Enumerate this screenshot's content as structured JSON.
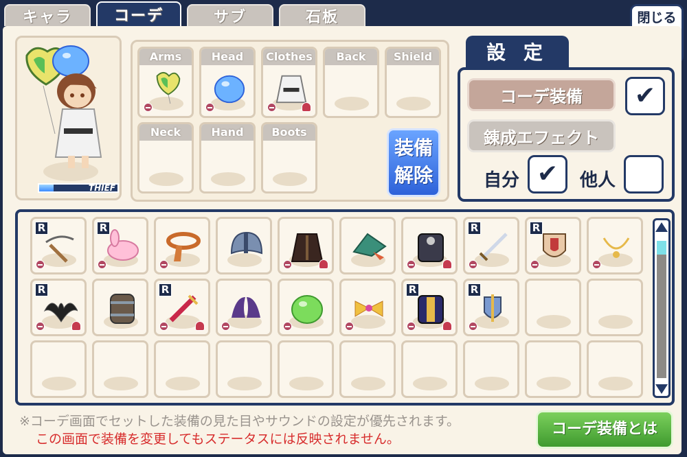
{
  "tabs": [
    "キャラ",
    "コーデ",
    "サブ",
    "石板"
  ],
  "close_label": "閉じる",
  "close_x": "✕",
  "character": {
    "class_label": "THIEF"
  },
  "slots": [
    {
      "label": "Arms",
      "item": "balloon-heart-icon",
      "minus": true,
      "pin": false
    },
    {
      "label": "Head",
      "item": "blue-slime-hat-icon",
      "minus": true,
      "pin": false
    },
    {
      "label": "Clothes",
      "item": "white-dress-icon",
      "minus": true,
      "pin": true
    },
    {
      "label": "Back",
      "item": "",
      "minus": false,
      "pin": false
    },
    {
      "label": "Shield",
      "item": "",
      "minus": false,
      "pin": false
    },
    {
      "label": "Neck",
      "item": "",
      "minus": false,
      "pin": false
    },
    {
      "label": "Hand",
      "item": "",
      "minus": false,
      "pin": false
    },
    {
      "label": "Boots",
      "item": "",
      "minus": false,
      "pin": false
    }
  ],
  "unequip_label_1": "装備",
  "unequip_label_2": "解除",
  "settings": {
    "title": "設 定",
    "coord_equip_label": "コーデ装備",
    "coord_equip_checked": "✔",
    "alchemy_effect_label": "錬成エフェクト",
    "self_label": "自分",
    "self_checked": "✔",
    "others_label": "他人",
    "others_checked": ""
  },
  "inventory": [
    {
      "icon": "whip-icon",
      "r": true,
      "minus": true,
      "pin": false
    },
    {
      "icon": "pink-rabbit-icon",
      "r": true,
      "minus": true,
      "pin": false
    },
    {
      "icon": "scarf-icon",
      "r": false,
      "minus": true,
      "pin": false
    },
    {
      "icon": "steel-helmet-icon",
      "r": false,
      "minus": false,
      "pin": false
    },
    {
      "icon": "dark-coat-icon",
      "r": false,
      "minus": true,
      "pin": true
    },
    {
      "icon": "green-hat-icon",
      "r": false,
      "minus": false,
      "pin": false
    },
    {
      "icon": "dark-armor-icon",
      "r": false,
      "minus": true,
      "pin": true
    },
    {
      "icon": "sword-icon",
      "r": true,
      "minus": true,
      "pin": false
    },
    {
      "icon": "red-shield-icon",
      "r": true,
      "minus": true,
      "pin": false
    },
    {
      "icon": "necklace-icon",
      "r": false,
      "minus": true,
      "pin": false
    },
    {
      "icon": "black-bat-icon",
      "r": true,
      "minus": true,
      "pin": true
    },
    {
      "icon": "barrel-icon",
      "r": false,
      "minus": false,
      "pin": false
    },
    {
      "icon": "red-dagger-icon",
      "r": true,
      "minus": true,
      "pin": true
    },
    {
      "icon": "purple-wings-icon",
      "r": false,
      "minus": true,
      "pin": false
    },
    {
      "icon": "green-slime-icon",
      "r": false,
      "minus": true,
      "pin": false
    },
    {
      "icon": "ribbon-icon",
      "r": false,
      "minus": true,
      "pin": false
    },
    {
      "icon": "gold-armor-icon",
      "r": true,
      "minus": true,
      "pin": true
    },
    {
      "icon": "winged-shield-icon",
      "r": true,
      "minus": true,
      "pin": false
    },
    {
      "icon": "",
      "r": false,
      "minus": false,
      "pin": false
    },
    {
      "icon": "",
      "r": false,
      "minus": false,
      "pin": false
    },
    {
      "icon": "",
      "r": false,
      "minus": false,
      "pin": false
    },
    {
      "icon": "",
      "r": false,
      "minus": false,
      "pin": false
    },
    {
      "icon": "",
      "r": false,
      "minus": false,
      "pin": false
    },
    {
      "icon": "",
      "r": false,
      "minus": false,
      "pin": false
    },
    {
      "icon": "",
      "r": false,
      "minus": false,
      "pin": false
    },
    {
      "icon": "",
      "r": false,
      "minus": false,
      "pin": false
    },
    {
      "icon": "",
      "r": false,
      "minus": false,
      "pin": false
    },
    {
      "icon": "",
      "r": false,
      "minus": false,
      "pin": false
    },
    {
      "icon": "",
      "r": false,
      "minus": false,
      "pin": false
    },
    {
      "icon": "",
      "r": false,
      "minus": false,
      "pin": false
    }
  ],
  "r_badge": "R",
  "note_info": "※コーデ画面でセットした装備の見た目やサウンドの設定が優先されます。",
  "note_warning": "この画面で装備を変更してもステータスには反映されません。",
  "help_button": "コーデ装備とは",
  "colors": {
    "navy": "#233966",
    "accent_blue": "#2e62d9",
    "green": "#3f9a2f",
    "warning_red": "#d72d2d"
  }
}
